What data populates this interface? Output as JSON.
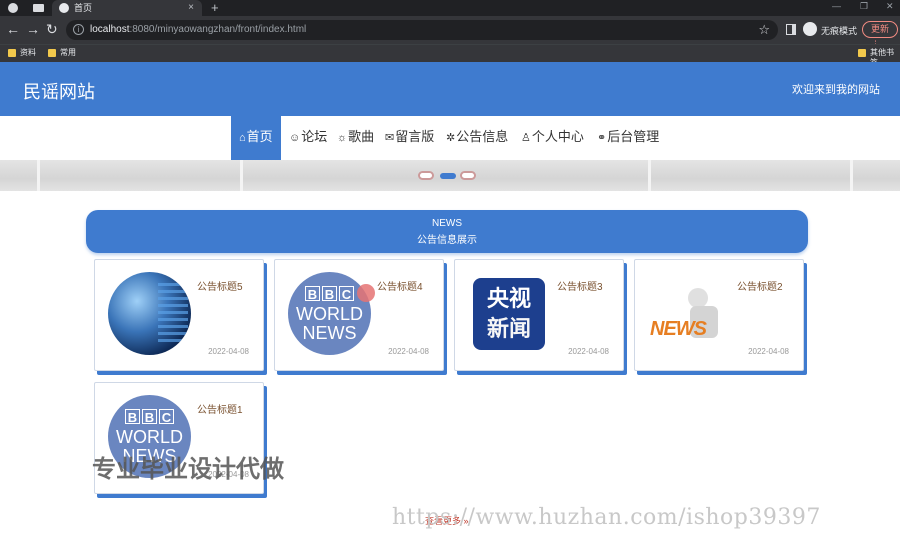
{
  "browser": {
    "tab_title": "首页",
    "url_host": "localhost",
    "url_rest": ":8080/minyaowangzhan/front/index.html",
    "incognito_label": "无痕模式",
    "update_label": "更新",
    "bookmarks": [
      "资料",
      "常用"
    ],
    "other_bookmarks": "其他书签"
  },
  "header": {
    "site_title": "民谣网站",
    "welcome": "欢迎来到我的网站"
  },
  "nav": {
    "items": [
      {
        "icon": "⌂",
        "label": "首页"
      },
      {
        "icon": "☺",
        "label": "论坛"
      },
      {
        "icon": "☼",
        "label": "歌曲"
      },
      {
        "icon": "✉",
        "label": "留言版"
      },
      {
        "icon": "✲",
        "label": "公告信息"
      },
      {
        "icon": "♙",
        "label": "个人中心"
      },
      {
        "icon": "⚭",
        "label": "后台管理"
      }
    ],
    "active_index": 0
  },
  "news_section": {
    "en_title": "NEWS",
    "cn_title": "公告信息展示"
  },
  "cards": [
    {
      "title": "公告标题5",
      "date": "2022-04-08",
      "image": "globe-network-image"
    },
    {
      "title": "公告标题4",
      "date": "2022-04-08",
      "image": "bbc-world-news-logo"
    },
    {
      "title": "公告标题3",
      "date": "2022-04-08",
      "image": "cctv-news-logo"
    },
    {
      "title": "公告标题2",
      "date": "2022-04-08",
      "image": "news-reader-figure"
    },
    {
      "title": "公告标题1",
      "date": "2022-04-08",
      "image": "bbc-world-news-logo"
    }
  ],
  "bbc": {
    "letters": [
      "B",
      "B",
      "C"
    ],
    "line1": "WORLD",
    "line2": "NEWS"
  },
  "cctv": {
    "line1": "央视",
    "line2": "新闻"
  },
  "news_figure_word": "NEWS",
  "pager": {
    "label": "查看更多 »"
  },
  "overlay": {
    "watermark": "专业毕业设计代做",
    "url": "https://www.huzhan.com/ishop39397"
  },
  "colors": {
    "accent": "#3f7bcf",
    "card_title": "#7a5230"
  }
}
